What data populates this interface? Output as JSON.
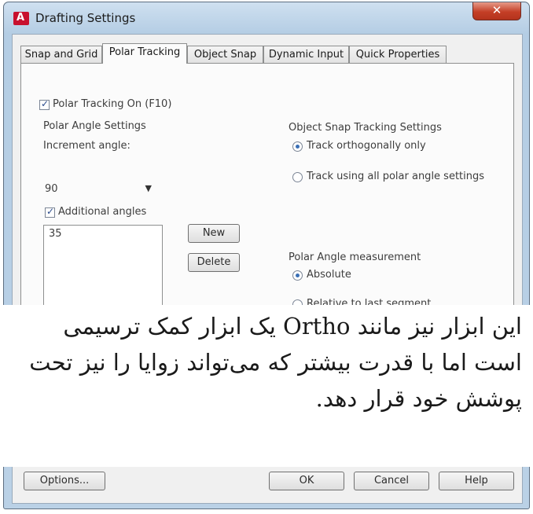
{
  "window": {
    "title": "Drafting Settings",
    "close_glyph": "✕",
    "app_icon": "autocad-icon"
  },
  "tabs": [
    {
      "label": "Snap and Grid"
    },
    {
      "label": "Polar Tracking"
    },
    {
      "label": "Object Snap"
    },
    {
      "label": "Dynamic Input"
    },
    {
      "label": "Quick Properties"
    }
  ],
  "polar": {
    "tracking_on_label": "Polar Tracking On (F10)",
    "tracking_on_checked": true,
    "angle_settings_label": "Polar Angle Settings",
    "increment_label": "Increment angle:",
    "increment_value": "90",
    "dropdown_arrow": "▼",
    "additional_label": "Additional angles",
    "additional_checked": true,
    "additional_values": [
      "35"
    ],
    "new_button": "New",
    "delete_button": "Delete"
  },
  "snap_tracking": {
    "group_label": "Object Snap Tracking Settings",
    "option_orthogonal": "Track orthogonally only",
    "option_all": "Track using all polar angle settings",
    "selected": "orthogonal"
  },
  "measurement": {
    "group_label": "Polar Angle measurement",
    "option_absolute": "Absolute",
    "option_relative": "Relative to last segment",
    "selected": "absolute"
  },
  "caption": "این ابزار نیز مانند Ortho یک ابزار کمک ترسیمی است اما با قدرت بیشتر که می‌تواند زوایا را نیز تحت پوشش خود قرار دهد.",
  "footer": {
    "options_button": "Options...",
    "ok_button": "OK",
    "cancel_button": "Cancel",
    "help_button": "Help"
  }
}
